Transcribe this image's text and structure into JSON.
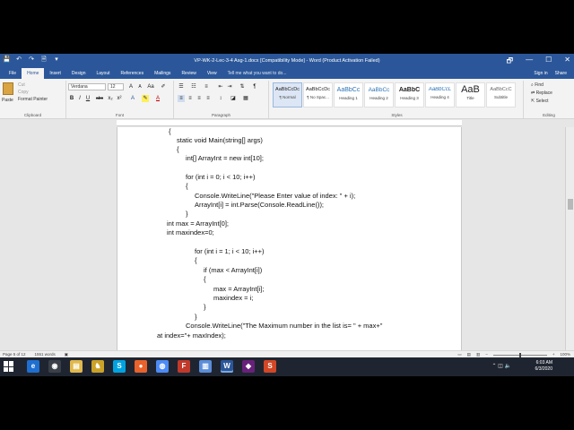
{
  "window": {
    "title": "VP-WK-2-Lec-3-4 Asg-1.docx [Compatibility Mode] - Word (Product Activation Failed)",
    "controls": [
      "🗗",
      "—",
      "☐",
      "✕"
    ]
  },
  "qat": [
    "💾",
    "↶",
    "↷",
    "🗎",
    "▾"
  ],
  "tabs": [
    "File",
    "Home",
    "Insert",
    "Design",
    "Layout",
    "References",
    "Mailings",
    "Review",
    "View"
  ],
  "tell_me": "Tell me what you want to do...",
  "account": {
    "sign_in": "Sign in",
    "share": "Share"
  },
  "clipboard": {
    "paste": "Paste",
    "cut": "Cut",
    "copy": "Copy",
    "format_painter": "Format Painter",
    "label": "Clipboard"
  },
  "font": {
    "name": "Verdana",
    "size": "12",
    "buttons": [
      "B",
      "I",
      "U",
      "abc",
      "x₂",
      "x²",
      "A",
      "A"
    ],
    "label": "Font"
  },
  "paragraph": {
    "label": "Paragraph"
  },
  "styles": {
    "items": [
      {
        "sample": "AaBbCcDc",
        "name": "¶ Normal"
      },
      {
        "sample": "AaBbCcDc",
        "name": "¶ No Spac..."
      },
      {
        "sample": "AaBbCc",
        "name": "Heading 1"
      },
      {
        "sample": "AaBbCc",
        "name": "Heading 2"
      },
      {
        "sample": "AaBbC",
        "name": "Heading 3"
      },
      {
        "sample": "AaBbCcL",
        "name": "Heading 4"
      },
      {
        "sample": "AaB",
        "name": "Title"
      },
      {
        "sample": "AaBbCcC",
        "name": "Subtitle"
      }
    ],
    "label": "Styles"
  },
  "editing": {
    "find": "Find",
    "replace": "Replace",
    "select": "Select",
    "label": "Editing"
  },
  "code_lines": [
    "{",
    "static void Main(string[] args)",
    "{",
    "int[] ArrayInt = new int[10];",
    "",
    "for (int i = 0; i < 10; i++)",
    "{",
    "Console.WriteLine(\"Please Enter value of index: \" + i);",
    "ArrayInt[i] = int.Parse(Console.ReadLine());",
    "}",
    "int max = ArrayInt[0];",
    "int maxindex=0;",
    "",
    "for (int i = 1; i < 10; i++)",
    "{",
    "if (max < ArrayInt[i])",
    "{",
    "max = ArrayInt[i];",
    "maxindex = i;",
    "}",
    "}",
    "Console.WriteLine(\"The Maximum number in the list is= \" + max+\"",
    "at index=\"+ maxIndex);"
  ],
  "status": {
    "page": "Page 5 of 12",
    "words": "1551 words",
    "zoom": "100%"
  },
  "taskbar": {
    "time": "6:03 AM",
    "date": "6/3/2020",
    "apps": [
      {
        "label": "e",
        "color": "#1e6fd0"
      },
      {
        "label": "◉",
        "color": "#3a3f48"
      },
      {
        "label": "▤",
        "color": "#e0b84b"
      },
      {
        "label": "♞",
        "color": "#c9a227"
      },
      {
        "label": "S",
        "color": "#00a3e0"
      },
      {
        "label": "●",
        "color": "#e8622c"
      },
      {
        "label": "◍",
        "color": "#4c8bf5"
      },
      {
        "label": "F",
        "color": "#c0392b"
      },
      {
        "label": "▥",
        "color": "#5b8dd9"
      },
      {
        "label": "W",
        "color": "#2b579a"
      },
      {
        "label": "◆",
        "color": "#68217a"
      },
      {
        "label": "S",
        "color": "#d24726"
      }
    ]
  }
}
